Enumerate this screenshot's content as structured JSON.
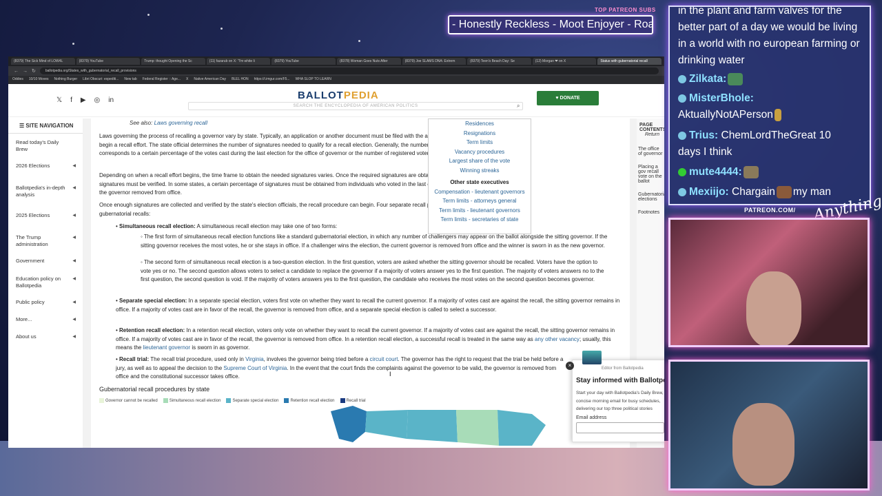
{
  "overlay": {
    "patreon_label": "TOP PATREON SUBS",
    "ticker_text": "- Honestly Reckless - Moot Enjoyer - Road",
    "patreon_url": "PATREON.COM/",
    "signature": "Anything"
  },
  "browser": {
    "tabs": [
      "(8379) The Sick Mind of LOW4L",
      "(8379) YouTube",
      "Trump: thought Opening the Sc",
      "(11) fazarub on X: \"I'm white li",
      "(8379) YouTube",
      "(8378) Woman Goes Nuts After",
      "(8379) Joe SLAMS DNA: Extrem",
      "(8379) Teen's Beach Day: Se",
      "(12) Morgan ❤ on X",
      "Status with gubernatorial recall"
    ],
    "url": "ballotpedia.org/States_with_gubernatorial_recall_provisions",
    "bookmarks": [
      "Oddies",
      "10/10 Moves",
      "Nothing Burger",
      "Libri Obscuri: expediti...",
      "New tab",
      "Federal Register :: Age...",
      "X",
      "Native American Day",
      "BLEL HON",
      "https://i.imgur.com/F5...",
      "WHA SLOP TO LEARN"
    ]
  },
  "site": {
    "logo_a": "BALLOT",
    "logo_b": "PEDIA",
    "search_placeholder": "SEARCH THE ENCYCLOPEDIA OF AMERICAN POLITICS",
    "donate_label": "DONATE"
  },
  "sidenav": {
    "title": "SITE NAVIGATION",
    "items": [
      "Read today's Daily Brew",
      "2026 Elections",
      "Ballotpedia's in-depth analysis",
      "2025 Elections",
      "The Trump administration",
      "Government",
      "Education policy on Ballotpedia",
      "Public policy",
      "More...",
      "About us"
    ]
  },
  "article": {
    "see_also_prefix": "See also:",
    "see_also_link": "Laws governing recall",
    "p1": "Laws governing the process of recalling a governor vary by state. Typically, an application or another document must be filed with the appropriate state official to begin a recall effort. The state official determines the number of signatures needed to qualify for a recall election. Generally, the number of signatures to be obtained corresponds to a certain percentage of the votes cast during the last election for the office of governor or the number of registered voters in the state.",
    "p2": "Depending on when a recall effort begins, the time frame to obtain the needed signatures varies. Once the required signatures are obtained and submitted, the signatures must be verified. In some states, a certain percentage of signatures must be obtained from individuals who voted in the last election and now want to see the governor removed from office.",
    "p3": "Once enough signatures are collected and verified by the state's election officials, the recall procedure can begin. Four separate recall procedures are in place for gubernatorial recalls:",
    "b1_title": "Simultaneous recall election:",
    "b1_text": "A simultaneous recall election may take one of two forms:",
    "b1a": "The first form of simultaneous recall election functions like a standard gubernatorial election, in which any number of challengers may appear on the ballot alongside the sitting governor. If the sitting governor receives the most votes, he or she stays in office. If a challenger wins the election, the current governor is removed from office and the winner is sworn in as the new governor.",
    "b1b": "The second form of simultaneous recall election is a two-question election. In the first question, voters are asked whether the sitting governor should be recalled. Voters have the option to vote yes or no. The second question allows voters to select a candidate to replace the governor if a majority of voters answer yes to the first question. The majority of voters answers no to the first question, the second question is void. If the majority of voters answers yes to the first question, the candidate who receives the most votes on the second question becomes governor.",
    "b2_title": "Separate special election:",
    "b2_text": "In a separate special election, voters first vote on whether they want to recall the current governor. If a majority of votes cast are against the recall, the sitting governor remains in office. If a majority of votes cast are in favor of the recall, the governor is removed from office, and a separate special election is called to select a successor.",
    "b3_title": "Retention recall election:",
    "b3_text_a": "In a retention recall election, voters only vote on whether they want to recall the current governor. If a majority of votes cast are against the recall, the sitting governor remains in office. If a majority of votes cast are in favor of the recall, the governor is removed from office. In a retention recall election, a successful recall is treated in the same way as",
    "b3_link1": "any other vacancy",
    "b3_text_b": "; usually, this means the",
    "b3_link2": "lieutenant governor",
    "b3_text_c": "is sworn in as governor.",
    "b4_title": "Recall trial:",
    "b4_text_a": "The recall trial procedure, used only in",
    "b4_link1": "Virginia",
    "b4_text_b": ", involves the governor being tried before a",
    "b4_link2": "circuit court",
    "b4_text_c": ". The governor has the right to request that the trial be held before a jury, as well as to appeal the decision to the",
    "b4_link3": "Supreme Court of Virginia",
    "b4_text_d": ". In the event that the court finds the complaints against the governor to be valid, the governor is removed from office and the constitutional successor takes office.",
    "map_title": "Gubernatorial recall procedures by state",
    "legend": [
      {
        "label": "Governor cannot be recalled",
        "color": "#e8f4d8"
      },
      {
        "label": "Simultaneous recall election",
        "color": "#a8dcb8"
      },
      {
        "label": "Separate special election",
        "color": "#5ab4c8"
      },
      {
        "label": "Retention recall election",
        "color": "#2a7ab0"
      },
      {
        "label": "Recall trial",
        "color": "#1a3a80"
      }
    ]
  },
  "infobox": {
    "links_top": [
      "Residences",
      "Resignations",
      "Term limits",
      "Vacancy procedures",
      "Largest share of the vote",
      "Winning streaks"
    ],
    "header": "Other state executives",
    "links_bottom": [
      "Compensation - lieutenant governors",
      "Term limits - attorneys general",
      "Term limits - lieutenant governors",
      "Term limits - secretaries of state"
    ]
  },
  "toc": {
    "title": "PAGE CONTENTS",
    "return": "Return",
    "items": [
      "The office of governor",
      "Placing a gov recall vote on the ballot",
      "Gubernatorial elections",
      "Footnotes"
    ]
  },
  "popup": {
    "from": "Editor from Ballotpedia",
    "title": "Stay informed with Ballotpedia",
    "body": "Start your day with Ballotpedia's Daily Brew, a concise morning email for busy schedules, delivering our top three political stories",
    "email_label": "Email address"
  },
  "chat": {
    "text_top": "in the plant and farm valves for the better part of a day we would be living in a world with no european farming or drinking water",
    "messages": [
      {
        "name": "Zilkata:",
        "text": ""
      },
      {
        "name": "MisterBhole:",
        "text": ""
      },
      {
        "name": "",
        "text": "AktuallyNotAPerson"
      },
      {
        "name": "Trius:",
        "text": "ChemLordTheGreat 10"
      },
      {
        "name": "",
        "text": "days I think"
      },
      {
        "name": "mute4444:",
        "text": ""
      },
      {
        "name": "Mexiijo:",
        "text": "Chargain"
      },
      {
        "name": "",
        "text": "my man"
      }
    ]
  }
}
